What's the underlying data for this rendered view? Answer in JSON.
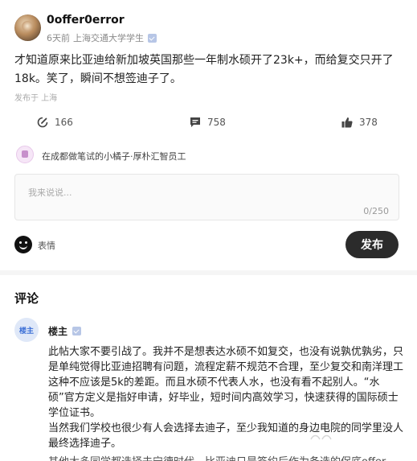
{
  "post": {
    "author": "0offer0error",
    "time": "6天前",
    "school": "上海交通大学学生",
    "text": "才知道原来比亚迪给新加坡英国那些一年制水硕开了23k+，而给复交只开了18k。笑了，瞬间不想签迪子了。",
    "location": "发布于 上海",
    "stats": {
      "edit_count": "166",
      "comment_count": "758",
      "like_count": "378"
    }
  },
  "composer": {
    "commenter": "在成都做笔试的小橘子·厚朴汇智员工",
    "placeholder": "我来说说...",
    "counter": "0/250",
    "emoji_label": "表情",
    "publish_label": "发布"
  },
  "comments": {
    "title": "评论",
    "items": [
      {
        "avatar_label": "楼主",
        "name": "楼主",
        "paragraphs": [
          "此帖大家不要引战了。我并不是想表达水硕不如复交，也没有说孰优孰劣，只是单纯觉得比亚迪招聘有问题，流程定薪不规范不合理，至少复交和南洋理工这种不应该是5k的差距。而且水硕不代表人水，也没有看不起别人。“水硕”官方定义是指好申请，好毕业，短时间内高效学习，快速获得的国际硕士学位证书。",
          "当然我们学校也很少有人会选择去迪子，至少我知道的身边电院的同学里没人最终选择迪子。"
        ],
        "cutoff_line": "其他大多同学都选择去宁德时代，比亚迪只是签约后作为备选的保底offer。"
      }
    ]
  },
  "colors": {
    "publish_bg": "#2b2b2b",
    "verified": "#b7c6e6",
    "owner_avatar_bg": "#dfe8f8"
  }
}
